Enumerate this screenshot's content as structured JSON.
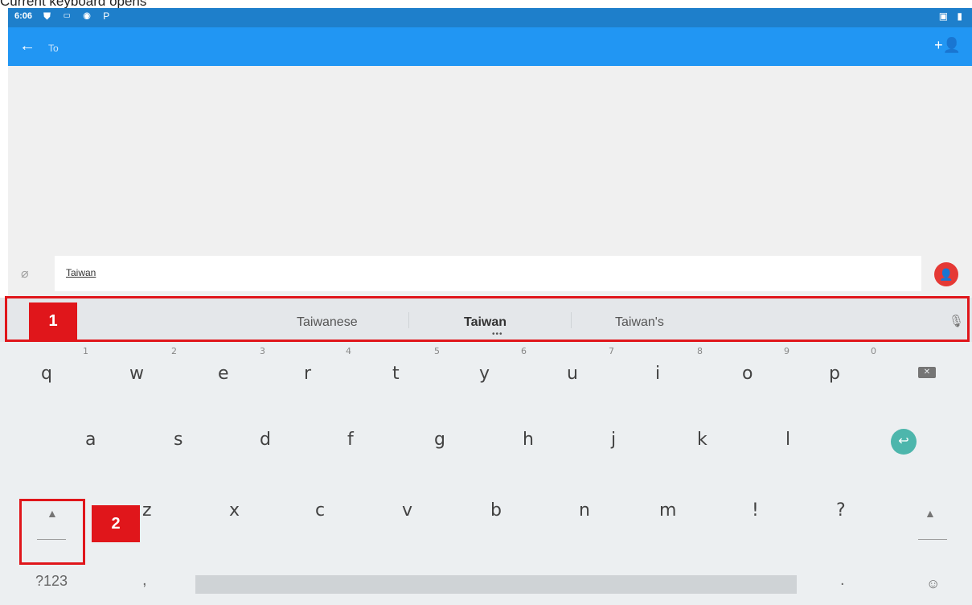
{
  "caption": "Current keyboard opens",
  "status_bar": {
    "time": "6:06",
    "left_icons": "⛊ ▭ ◉ P",
    "right_icons": "▣ ▮"
  },
  "app_bar": {
    "to_placeholder": "To",
    "back_icon": "←",
    "add_person_icon": "+👤"
  },
  "compose": {
    "message_text": "Taiwan",
    "attach_icon": "⌀",
    "send_icon": "👤"
  },
  "suggestions": {
    "left": "Taiwanese",
    "center": "Taiwan",
    "right": "Taiwan's",
    "more_dots": "•••"
  },
  "keyboard": {
    "row1": [
      "q",
      "w",
      "e",
      "r",
      "t",
      "y",
      "u",
      "i",
      "o",
      "p"
    ],
    "row1_hints": [
      "1",
      "2",
      "3",
      "4",
      "5",
      "6",
      "7",
      "8",
      "9",
      "0"
    ],
    "row2": [
      "a",
      "s",
      "d",
      "f",
      "g",
      "h",
      "j",
      "k",
      "l"
    ],
    "row3": [
      "z",
      "x",
      "c",
      "v",
      "b",
      "n",
      "m",
      "!",
      "?"
    ],
    "symbols_key": "?123",
    "comma_key": ",",
    "period_key": ".",
    "backspace_icon": "✕",
    "enter_icon": "↩",
    "shift_icon": "▲",
    "mic_icon": "🎙",
    "emoji_icon": "☺"
  },
  "annotations": {
    "label1": "1",
    "label2": "2"
  },
  "colors": {
    "statusbar": "#1e7fcb",
    "appbar": "#2196f3",
    "annotation": "#e0161b",
    "send": "#e53935",
    "enter": "#4db6ac"
  }
}
